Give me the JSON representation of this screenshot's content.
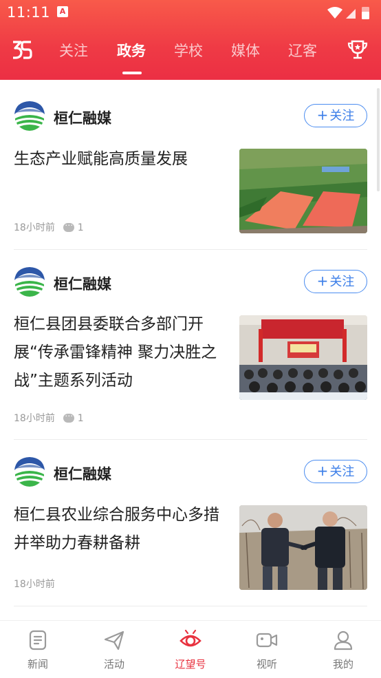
{
  "status_bar": {
    "time": "11:11",
    "notification_letter": "A"
  },
  "tabs": [
    {
      "label": "关注",
      "active": false
    },
    {
      "label": "政务",
      "active": true
    },
    {
      "label": "学校",
      "active": false
    },
    {
      "label": "媒体",
      "active": false
    },
    {
      "label": "辽客",
      "active": false
    }
  ],
  "feed": [
    {
      "source": "桓仁融媒",
      "follow": "关注",
      "title": "生态产业赋能高质量发展",
      "time": "18小时前",
      "comments": "1"
    },
    {
      "source": "桓仁融媒",
      "follow": "关注",
      "title": "桓仁县团县委联合多部门开展“传承雷锋精神 聚力决胜之战”主题系列活动",
      "time": "18小时前",
      "comments": "1"
    },
    {
      "source": "桓仁融媒",
      "follow": "关注",
      "title": "桓仁县农业综合服务中心多措并举助力春耕备耕",
      "time": "18小时前",
      "comments": ""
    }
  ],
  "bottom_nav": [
    {
      "label": "新闻",
      "icon": "news-icon",
      "active": false
    },
    {
      "label": "活动",
      "icon": "paper-plane-icon",
      "active": false
    },
    {
      "label": "辽望号",
      "icon": "eye-icon",
      "active": true
    },
    {
      "label": "视听",
      "icon": "video-icon",
      "active": false
    },
    {
      "label": "我的",
      "icon": "profile-icon",
      "active": false
    }
  ],
  "colors": {
    "brand_red": "#ec2f44",
    "follow_blue": "#3b7ee8",
    "active_nav": "#e8323f"
  }
}
